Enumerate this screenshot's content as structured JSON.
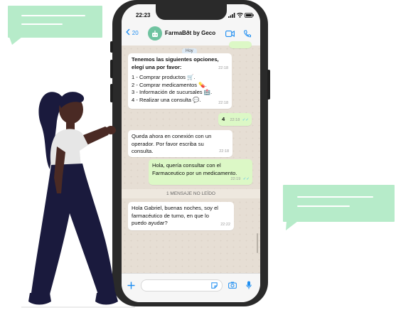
{
  "status": {
    "time": "22:23"
  },
  "header": {
    "back_count": "20",
    "contact_name": "FarmaBðt by Geco",
    "avatar_text": ""
  },
  "chat": {
    "date_chip": "Hoy",
    "messages": [
      {
        "id": "m1",
        "direction": "in",
        "lines": [
          "Tenemos las siguientes opciones,",
          "elegí una por favor:",
          "",
          "1 - Comprar productos 🛒.",
          "2 - Comprar medicamentos 💊.",
          "3 - Información de sucursales 🏥.",
          "4 - Realizar una consulta 💬."
        ],
        "time_top": "22:18",
        "time": "22:18"
      },
      {
        "id": "m2",
        "direction": "out",
        "lines": [
          "4"
        ],
        "time": "22:18"
      },
      {
        "id": "m3",
        "direction": "in",
        "lines": [
          "Queda ahora en conexión con un",
          "operador. Por favor escriba su",
          "consulta."
        ],
        "time": "22:18"
      },
      {
        "id": "m4",
        "direction": "out",
        "lines": [
          "Hola, quería consultar con el",
          "Farmaceutico por un medicamento."
        ],
        "time": "22:19"
      },
      {
        "id": "m5",
        "direction": "in",
        "lines": [
          "Hola Gabriel, buenas noches, soy el",
          "farmacéutico de turno, en que lo",
          "puedo ayudar?"
        ],
        "time": "22:22"
      }
    ],
    "unread_banner": "1 MENSAJE NO LEÍDO"
  },
  "colors": {
    "bubble": "#b6ebc9",
    "outgoing": "#dcf8c6",
    "accent": "#1f8ef1",
    "figure": "#1a1a3d"
  },
  "icons": [
    "back-chevron-icon",
    "video-call-icon",
    "phone-call-icon",
    "plus-icon",
    "sticker-icon",
    "camera-icon",
    "microphone-icon",
    "double-check-icon"
  ]
}
